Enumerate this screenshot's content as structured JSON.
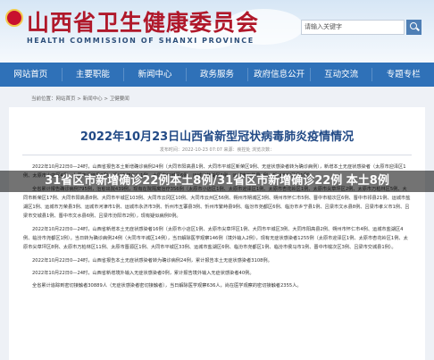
{
  "header": {
    "site_title": "山西省卫生健康委员会",
    "site_subtitle": "HEALTH COMMISSION OF SHANXI PROVINCE",
    "search_text": "请输入关键字",
    "search_icon": "search-icon"
  },
  "nav": {
    "items": [
      "网站首页",
      "主要职能",
      "新闻中心",
      "政务服务",
      "政府信息公开",
      "互动交流",
      "专题专栏"
    ]
  },
  "breadcrumb": "当前位置：网站首页 > 新闻中心 > 卫健要闻",
  "article": {
    "title": "2022年10月23日山西省新型冠状病毒肺炎疫情情况",
    "meta": "发布时间：2022-10-23 07:07  来源：疾控处  浏览次数：",
    "paragraphs": [
      "2022年10月22日0—24时，山西省报告本土新增确诊病例24例（大同市阳高县1例、大同市平城区新荣区9例、无症状感染者转为确诊病例），新增本土无症状感染者（太原市迎泽区1例、太原市小店区4例、太原市清徐县2例、朔州市怀仁市1例、大同市平城区6例、运城市盐湖区1例、运城市万荣县1例、忻州市宁武县1例）。",
      "全省累计报告确诊病例795例，治愈出院439例，现有在院隔离治疗356例（太原市小店区1例、太原市迎泽区1例、太原市杏花岭区1例、太原市尖草坪区2例、太原市万柏林区5例、大同市新荣区17例、大同市阳高县8例、大同市平城区103例、大同市云冈区10例、大同市云州区56例、朔州市朔城区3例、朔州市怀仁市5例、晋中市榆次区6例、晋中市祁县21例、运城市盐湖区1例、运城市万荣县3例、运城市河津市1例、运城市永济市3例、忻州市五寨县3例、忻州市繁峙县9例、临汾市尧都区6例、临汾市乡宁县1例、吕梁市文水县8例、吕梁市孝义市1例、吕梁市交城县1例、晋中市文水县6例、吕梁市汾阳市2例），现有疑似病例0例。",
      "2022年10月22日0—24时，山西省新增本土无症状感染者16例（太原市小店区1例、太原市尖草坪区1例、大同市平城区3例、大同市阳高县2例、朔州市怀仁市4例、运城市盐湖区4例、临汾市尧都区1例）。当日转为确诊病例24例（大同市平城区14例），当日解除医学观察146例（境外输入2例），现有无症状感染者1255例（太原市迎泽区1例、太原市杏花岭区1例、太原市尖草坪区8例、太原市万柏林区11例、太原市晋源区1例、大同市平城区33例、运城市盐湖区6例、临汾市尧都区1例、临汾市侯马市1例、晋中市榆次区3例、吕梁市交城县1例）。",
      "2022年10月22日0—24时，山西省报告本土无症状感染者转为确诊病例24例，累计报告本土无症状感染者3108例。",
      "2022年10月22日0—24时，山西省新增境外输入无症状感染者0例，累计报告境外输入无症状感染者40例。",
      "全省累计追踪到密切接触者30889人（无症状感染者密切接触者），当日解除医学观察636人，尚在医学观察的密切接触者2355人。"
    ]
  },
  "overlay_caption": "31省区市新增确诊22例本土8例/31省区市新增确诊22例 本土8例"
}
